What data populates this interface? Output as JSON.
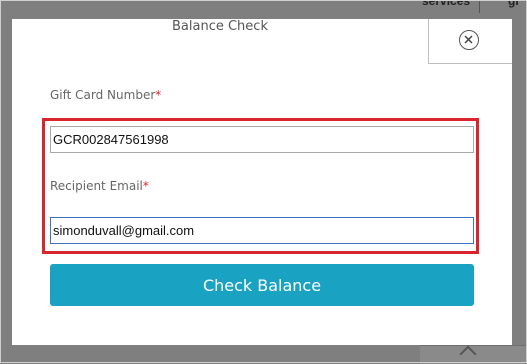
{
  "background": {
    "nav_services": "services",
    "nav_partial": "gi"
  },
  "modal": {
    "title": "Balance Check",
    "close_icon": "close-circle-icon"
  },
  "form": {
    "gift_card_label": "Gift Card Number",
    "gift_card_required": "*",
    "gift_card_value": "GCR002847561998",
    "email_label": "Recipient Email",
    "email_required": "*",
    "email_value": "simonduvall@gmail.com",
    "submit_label": "Check Balance"
  },
  "colors": {
    "accent": "#1aa2c3",
    "highlight": "#d9252e",
    "required": "#d9252e"
  }
}
